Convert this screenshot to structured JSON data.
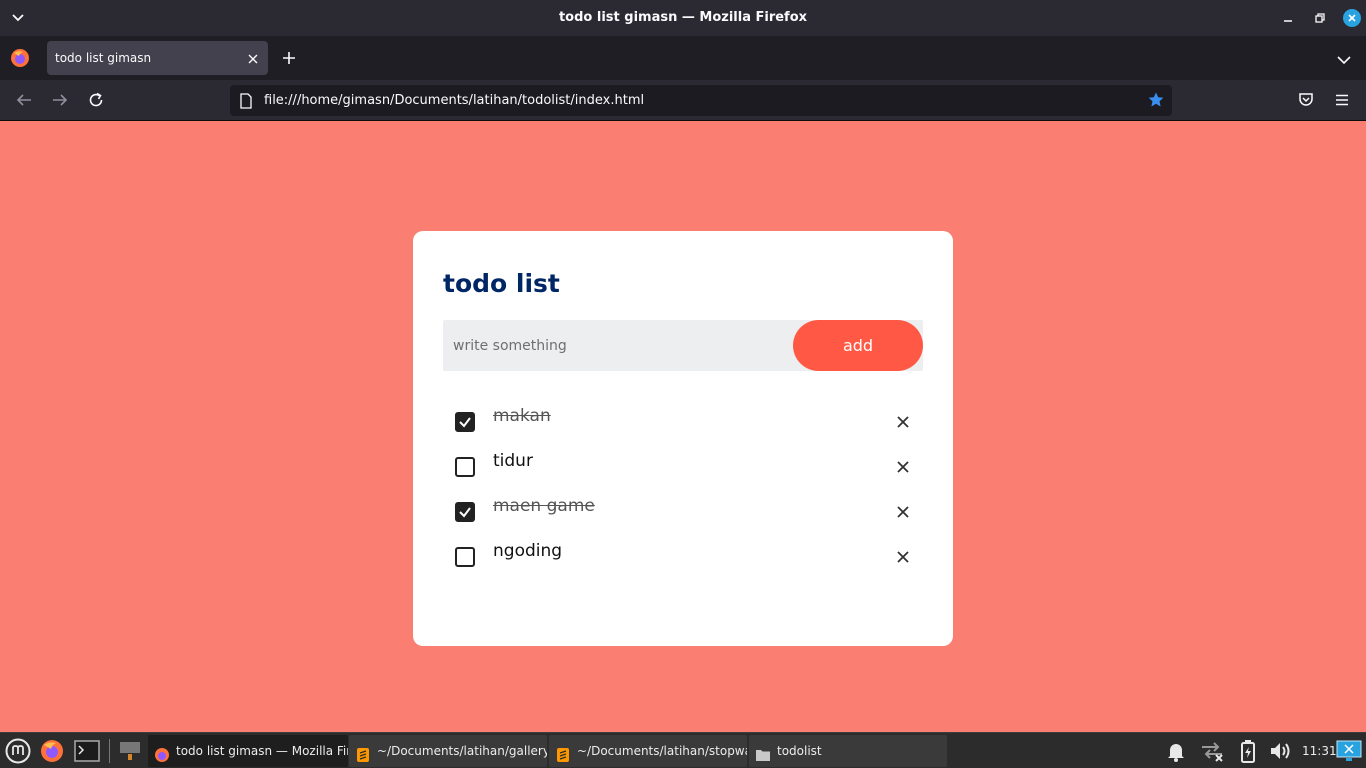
{
  "window": {
    "title": "todo list gimasn — Mozilla Firefox"
  },
  "browser": {
    "tab_title": "todo list gimasn",
    "url": "file:///home/gimasn/Documents/latihan/todolist/index.html"
  },
  "app": {
    "heading": "todo list",
    "input_placeholder": "write something",
    "add_label": "add",
    "todos": [
      {
        "text": "makan",
        "checked": true
      },
      {
        "text": "tidur",
        "checked": false
      },
      {
        "text": "maen game",
        "checked": true
      },
      {
        "text": "ngoding",
        "checked": false
      }
    ]
  },
  "taskbar": {
    "tasks": [
      {
        "label": "todo list gimasn — Mozilla Firefox",
        "icon": "firefox-icon"
      },
      {
        "label": "~/Documents/latihan/gallery/sc...",
        "icon": "sublime-text-icon"
      },
      {
        "label": "~/Documents/latihan/stopwatch...",
        "icon": "sublime-text-icon"
      },
      {
        "label": "todolist",
        "icon": "folder-icon"
      }
    ],
    "clock": "11:31"
  },
  "colors": {
    "page_background": "#fa7f72",
    "heading": "#002765",
    "accent_button": "#ff5945"
  }
}
